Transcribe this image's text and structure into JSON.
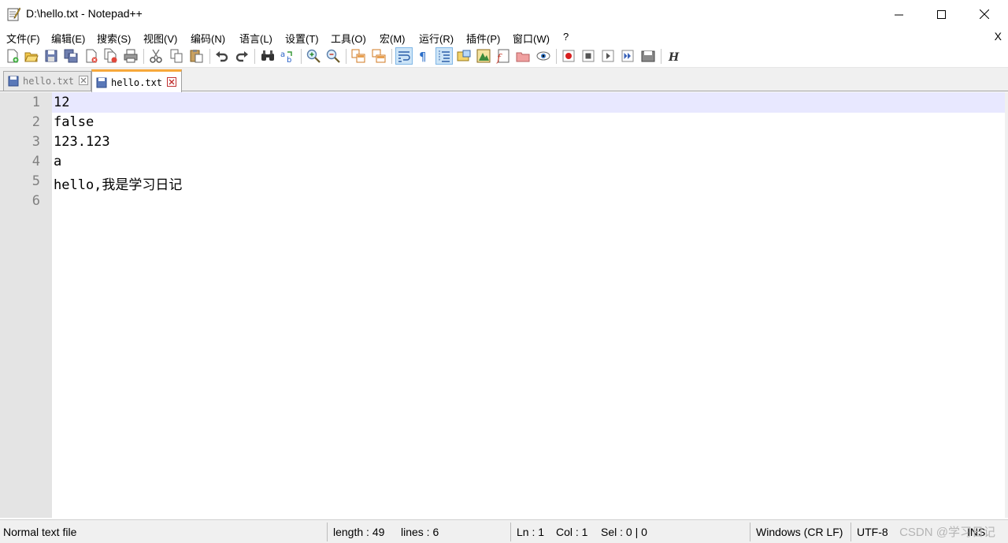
{
  "window": {
    "title": "D:\\hello.txt - Notepad++",
    "minimize": "—",
    "maximize": "☐",
    "close": "✕"
  },
  "menu": {
    "items": [
      "文件(F)",
      "编辑(E)",
      "搜索(S)",
      "视图(V)",
      "编码(N)",
      "语言(L)",
      "设置(T)",
      "工具(O)",
      "宏(M)",
      "运行(R)",
      "插件(P)",
      "窗口(W)",
      "?"
    ],
    "close_doc": "X"
  },
  "tabs": [
    {
      "label": "hello.txt",
      "active": false
    },
    {
      "label": "hello.txt",
      "active": true
    }
  ],
  "editor": {
    "line_numbers": [
      "1",
      "2",
      "3",
      "4",
      "5",
      "6"
    ],
    "lines": [
      "12",
      "false",
      "123.123",
      "a",
      "hello,我是学习日记",
      ""
    ]
  },
  "status": {
    "file_type": "Normal text file",
    "length": "length : 49",
    "lines": "lines : 6",
    "ln": "Ln : 1",
    "col": "Col : 1",
    "sel": "Sel : 0 | 0",
    "eol": "Windows (CR LF)",
    "encoding": "UTF-8",
    "mode": "INS",
    "watermark": "CSDN @学习日记"
  }
}
